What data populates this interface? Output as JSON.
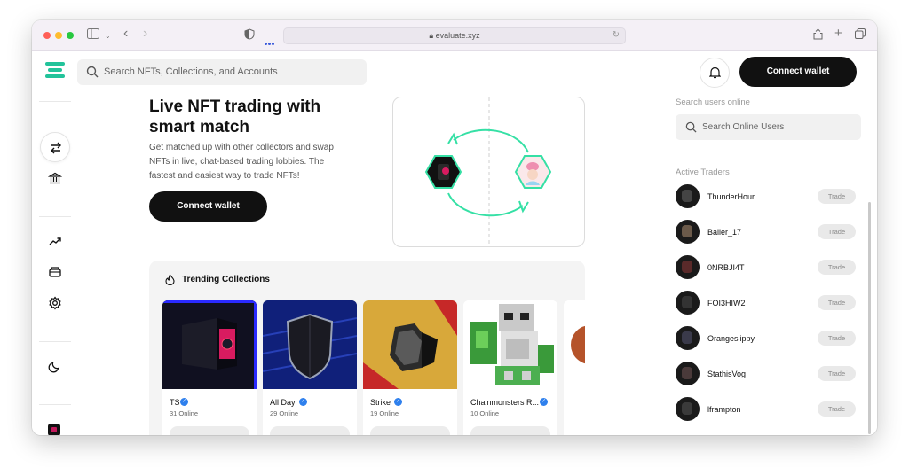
{
  "browser": {
    "url": "evaluate.xyz",
    "icons": [
      "sidebar-icon",
      "chevron-down-icon",
      "back-icon",
      "forward-icon",
      "shield-icon",
      "lock-icon",
      "reload-icon",
      "share-icon",
      "new-tab-icon",
      "tabs-overview-icon"
    ]
  },
  "header": {
    "search_placeholder": "Search NFTs, Collections, and Accounts",
    "connect_label": "Connect wallet"
  },
  "rail": {
    "icons": [
      "swap-icon",
      "bank-icon",
      "trending-up-icon",
      "wallet-icon",
      "settings-icon",
      "moon-icon"
    ]
  },
  "hero": {
    "title": "Live NFT trading with smart match",
    "description": "Get matched up with other collectors and swap NFTs in live, chat-based trading lobbies. The fastest and easiest way to trade NFTs!",
    "button_label": "Connect wallet"
  },
  "trending": {
    "title": "Trending Collections",
    "collections": [
      {
        "name": "TS",
        "online": "31 Online"
      },
      {
        "name": "All Day",
        "online": "29 Online"
      },
      {
        "name": "Strike",
        "online": "19 Online"
      },
      {
        "name": "Chainmonsters R...",
        "online": "10 Online"
      }
    ]
  },
  "sidebar": {
    "search_label": "Search users online",
    "search_placeholder": "Search Online Users",
    "traders_label": "Active Traders",
    "trade_label": "Trade",
    "traders": [
      {
        "name": "ThunderHour"
      },
      {
        "name": "Baller_17"
      },
      {
        "name": "0NRBJI4T"
      },
      {
        "name": "FOI3HIW2"
      },
      {
        "name": "Orangeslippy"
      },
      {
        "name": "StathisVog"
      },
      {
        "name": "lframpton"
      }
    ]
  },
  "colors": {
    "accent": "#22c39a",
    "dark": "#111111",
    "verified": "#2f80ed"
  }
}
